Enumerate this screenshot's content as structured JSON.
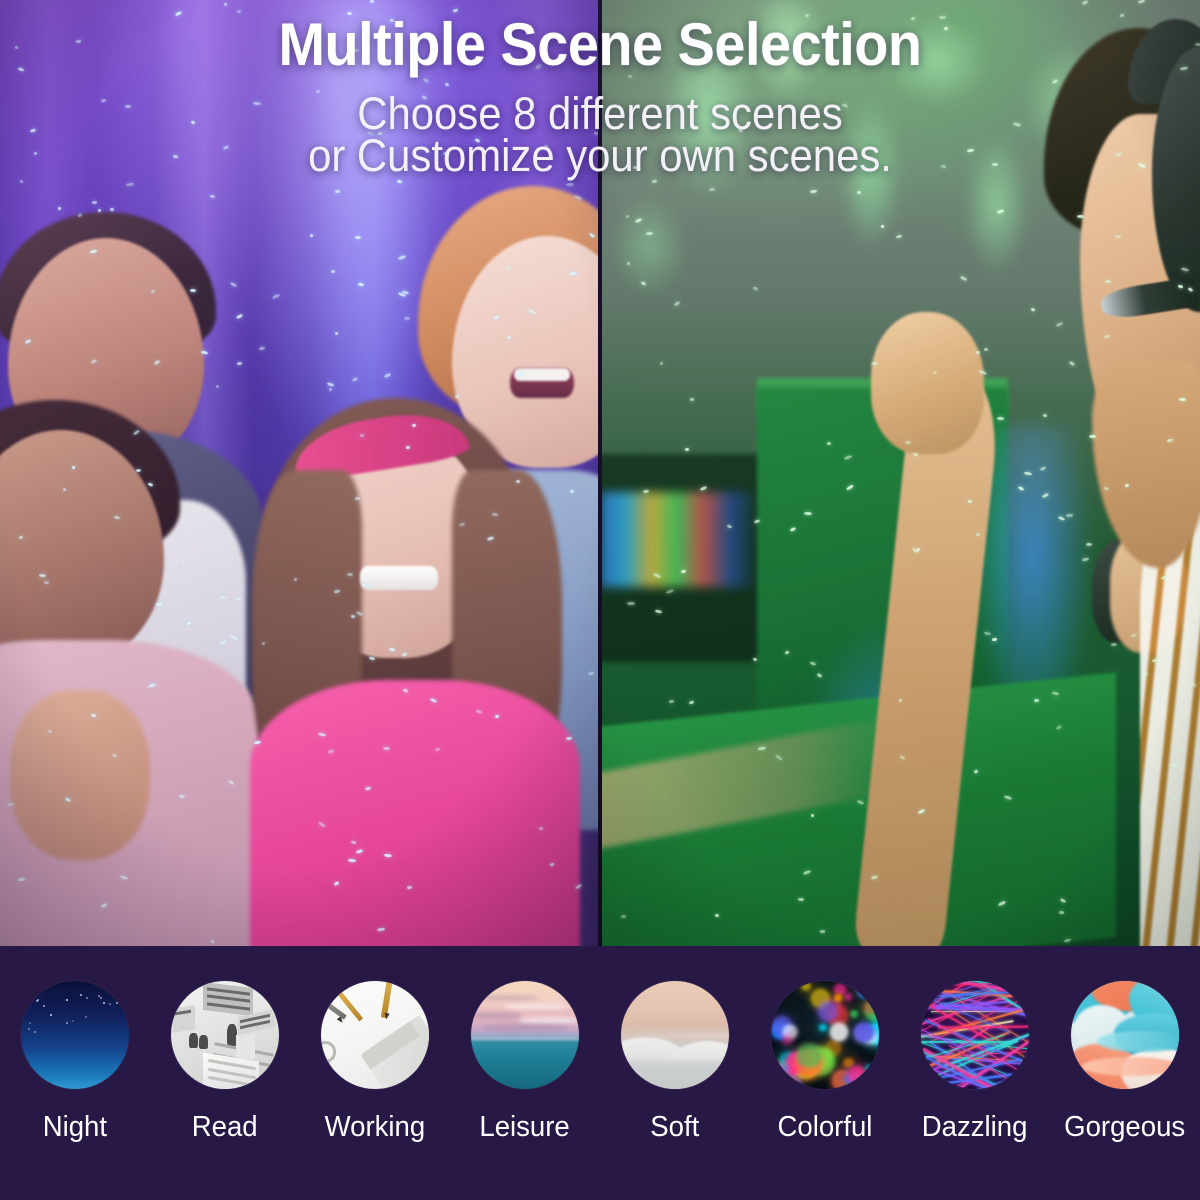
{
  "header": {
    "headline": "Multiple Scene Selection",
    "subline_1": "Choose 8 different scenes",
    "subline_2": "or Customize your own scenes."
  },
  "photos": {
    "left": {
      "name": "kids-watching-purple-star-projection",
      "alt": "Four smiling children sitting together under a purple and blue starry light projection"
    },
    "right": {
      "name": "gamer-celebrating-green-nebula-projection",
      "alt": "Man wearing a gaming headset raising his fist in celebration under a green nebula light projection"
    }
  },
  "scene_strip": {
    "background_color": "#281845",
    "label_color": "#ffffff",
    "count": 8,
    "scenes": [
      {
        "id": "night",
        "label": "Night",
        "icon": "night-sky-thumbnail",
        "accent": "#14438c"
      },
      {
        "id": "read",
        "label": "Read",
        "icon": "library-thumbnail",
        "accent": "#e2e2e0"
      },
      {
        "id": "working",
        "label": "Working",
        "icon": "desk-keyboard-thumbnail",
        "accent": "#f4f4f2"
      },
      {
        "id": "leisure",
        "label": "Leisure",
        "icon": "ocean-sunset-thumbnail",
        "accent": "#1d7f96"
      },
      {
        "id": "soft",
        "label": "Soft",
        "icon": "pale-dunes-thumbnail",
        "accent": "#ddbcab"
      },
      {
        "id": "colorful",
        "label": "Colorful",
        "icon": "bokeh-lights-thumbnail",
        "accent": "#10212b"
      },
      {
        "id": "dazzling",
        "label": "Dazzling",
        "icon": "light-streaks-thumbnail",
        "accent": "#3d1a6e"
      },
      {
        "id": "gorgeous",
        "label": "Gorgeous",
        "icon": "marble-swirl-thumbnail",
        "accent": "#6fd3dd"
      }
    ]
  }
}
